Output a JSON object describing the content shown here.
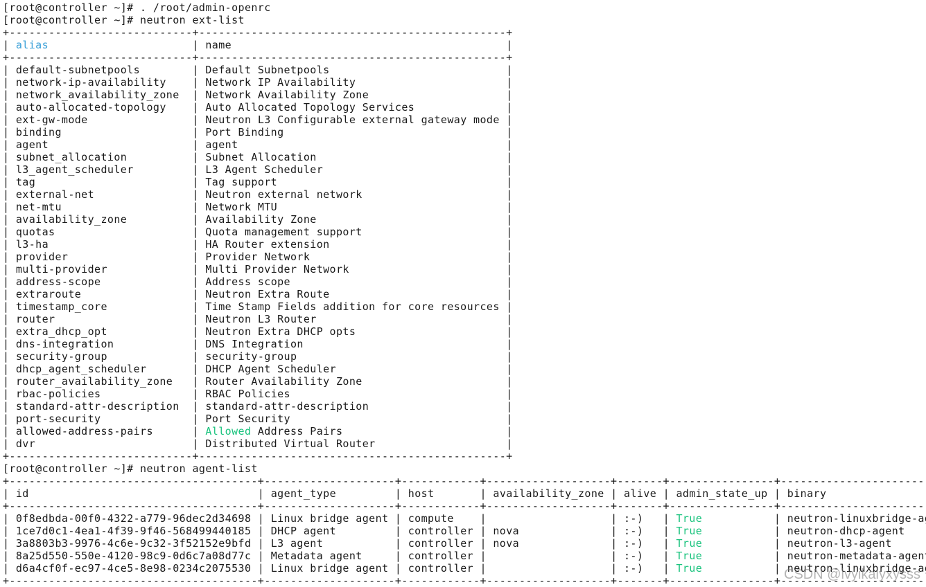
{
  "colors": {
    "background": "#ffffff",
    "text": "#1a1a1a",
    "header_highlight": "#3aa0d8",
    "true_highlight": "#19c37d"
  },
  "session": {
    "prompt": "[root@controller ~]#",
    "commands": [
      "[root@controller ~]# . /root/admin-openrc",
      "[root@controller ~]# neutron ext-list",
      "[root@controller ~]# neutron agent-list"
    ]
  },
  "ext_list": {
    "headers": {
      "alias": "alias",
      "name": "name"
    },
    "rows": [
      {
        "alias": "default-subnetpools",
        "name": "Default Subnetpools"
      },
      {
        "alias": "network-ip-availability",
        "name": "Network IP Availability"
      },
      {
        "alias": "network_availability_zone",
        "name": "Network Availability Zone"
      },
      {
        "alias": "auto-allocated-topology",
        "name": "Auto Allocated Topology Services"
      },
      {
        "alias": "ext-gw-mode",
        "name": "Neutron L3 Configurable external gateway mode"
      },
      {
        "alias": "binding",
        "name": "Port Binding"
      },
      {
        "alias": "agent",
        "name": "agent"
      },
      {
        "alias": "subnet_allocation",
        "name": "Subnet Allocation"
      },
      {
        "alias": "l3_agent_scheduler",
        "name": "L3 Agent Scheduler"
      },
      {
        "alias": "tag",
        "name": "Tag support"
      },
      {
        "alias": "external-net",
        "name": "Neutron external network"
      },
      {
        "alias": "net-mtu",
        "name": "Network MTU"
      },
      {
        "alias": "availability_zone",
        "name": "Availability Zone"
      },
      {
        "alias": "quotas",
        "name": "Quota management support"
      },
      {
        "alias": "l3-ha",
        "name": "HA Router extension"
      },
      {
        "alias": "provider",
        "name": "Provider Network"
      },
      {
        "alias": "multi-provider",
        "name": "Multi Provider Network"
      },
      {
        "alias": "address-scope",
        "name": "Address scope"
      },
      {
        "alias": "extraroute",
        "name": "Neutron Extra Route"
      },
      {
        "alias": "timestamp_core",
        "name": "Time Stamp Fields addition for core resources"
      },
      {
        "alias": "router",
        "name": "Neutron L3 Router"
      },
      {
        "alias": "extra_dhcp_opt",
        "name": "Neutron Extra DHCP opts"
      },
      {
        "alias": "dns-integration",
        "name": "DNS Integration"
      },
      {
        "alias": "security-group",
        "name": "security-group"
      },
      {
        "alias": "dhcp_agent_scheduler",
        "name": "DHCP Agent Scheduler"
      },
      {
        "alias": "router_availability_zone",
        "name": "Router Availability Zone"
      },
      {
        "alias": "rbac-policies",
        "name": "RBAC Policies"
      },
      {
        "alias": "standard-attr-description",
        "name": "standard-attr-description"
      },
      {
        "alias": "port-security",
        "name": "Port Security"
      },
      {
        "alias": "allowed-address-pairs",
        "name": "Allowed Address Pairs"
      },
      {
        "alias": "dvr",
        "name": "Distributed Virtual Router"
      }
    ]
  },
  "agent_list": {
    "headers": [
      "id",
      "agent_type",
      "host",
      "availability_zone",
      "alive",
      "admin_state_up",
      "binary"
    ],
    "rows": [
      [
        "0f8edbda-00f0-4322-a779-96dec2d34698",
        "Linux bridge agent",
        "compute",
        "",
        ":-)",
        "True",
        "neutron-linuxbridge-agent"
      ],
      [
        "1ce7d0c1-4ea1-4f39-9f46-568499440185",
        "DHCP agent",
        "controller",
        "nova",
        ":-)",
        "True",
        "neutron-dhcp-agent"
      ],
      [
        "3a8803b3-9976-4c6e-9c32-3f52152e9bfd",
        "L3 agent",
        "controller",
        "nova",
        ":-)",
        "True",
        "neutron-l3-agent"
      ],
      [
        "8a25d550-550e-4120-98c9-0d6c7a08d77c",
        "Metadata agent",
        "controller",
        "",
        ":-)",
        "True",
        "neutron-metadata-agent"
      ],
      [
        "d6a4cf0f-ec97-4ce5-8e98-0234c2075530",
        "Linux bridge agent",
        "controller",
        "",
        ":-)",
        "True",
        "neutron-linuxbridge-agent"
      ]
    ]
  },
  "watermark": "CSDN @lvyikaiyxysss"
}
